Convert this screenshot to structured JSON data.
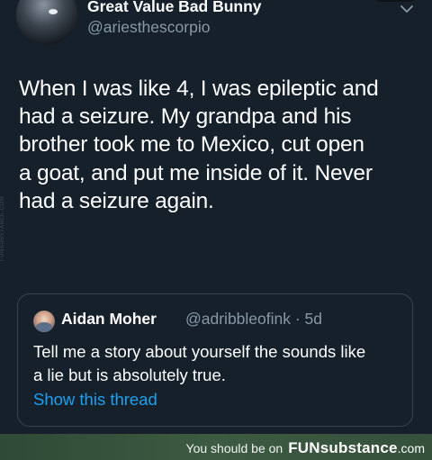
{
  "tweet": {
    "display_name": "Great Value Bad Bunny",
    "handle": "@ariesthescorpio",
    "text_lines": [
      "When I was like 4, I was epileptic and",
      "had a seizure. My grandpa and his",
      "brother took me to Mexico, cut open",
      "a goat, and put me inside of it. Never",
      "had a seizure again."
    ],
    "menu_icon": "chevron-down-icon",
    "side_watermark": "FUNSUBSTANCE.COM"
  },
  "quoted_tweet": {
    "display_name": "Aidan Moher",
    "handle_meta": "@adribbleofink · 5d",
    "text_lines": [
      "Tell me a story about yourself the sounds like",
      "a lie but is absolutely true."
    ],
    "thread_link": "Show this thread",
    "link_color": "#1da1f2"
  },
  "footer": {
    "prefix": "You should be on",
    "brand": "FUNsubstance",
    "domain": ".com",
    "bar_color": "#37553d"
  },
  "colors": {
    "background": "#15202b",
    "secondary_text": "#8899a6",
    "border": "#38444d"
  }
}
